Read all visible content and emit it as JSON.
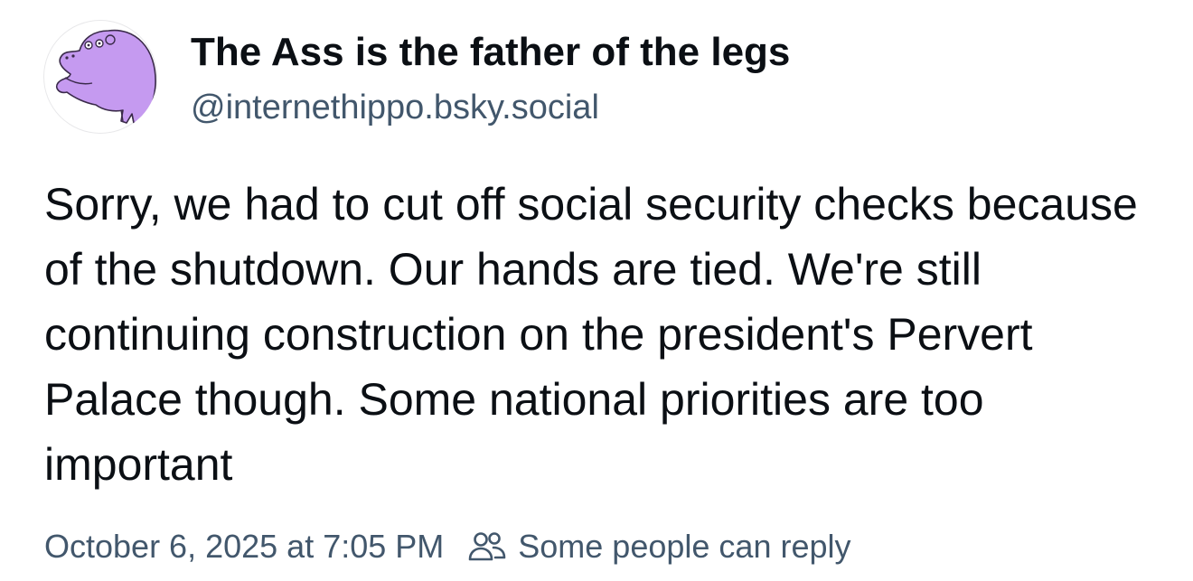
{
  "post": {
    "author": {
      "display_name": "The Ass is the father of the legs",
      "handle": "@internethippo.bsky.social",
      "avatar_icon": "hippo-avatar-icon",
      "avatar_color": "#c59af0"
    },
    "text": "Sorry, we had to cut off social security checks because of the shutdown. Our hands are tied. We're still continuing construction on the president's Pervert Palace though. Some national priorities are too important",
    "timestamp": "October 6, 2025 at 7:05 PM",
    "reply_setting": {
      "icon": "people-icon",
      "label": "Some people can reply"
    },
    "colors": {
      "text": "#0b0f14",
      "secondary": "#42576c"
    }
  }
}
